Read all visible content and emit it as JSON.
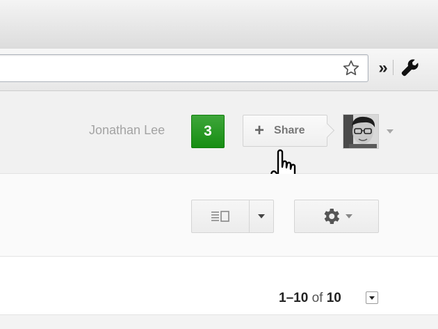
{
  "header": {
    "user_name": "Jonathan Lee",
    "notification_count": "3",
    "share_label": "Share"
  },
  "pagination": {
    "range": "1–10",
    "of_label": "of",
    "total": "10"
  },
  "colors": {
    "badge_green": "#1c931a",
    "button_border": "#d2d2d2",
    "name_gray": "#a3a3a3"
  },
  "icons": {
    "bookmark": "star-icon",
    "extensions": "chevron-double-right-icon",
    "menu": "wrench-icon",
    "share": "plus-icon",
    "view": "split-pane-icon",
    "settings": "gear-icon",
    "cursor": "hand-pointer-icon"
  }
}
